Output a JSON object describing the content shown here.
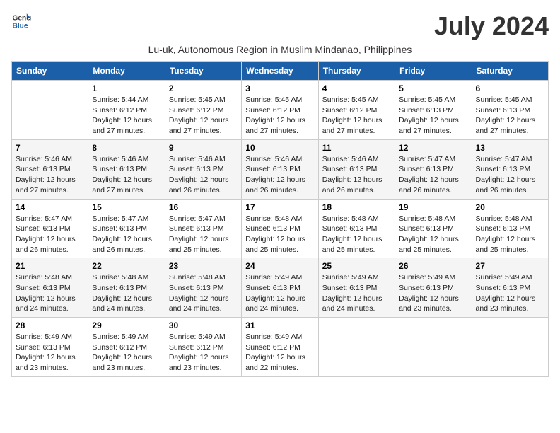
{
  "logo": {
    "line1": "General",
    "line2": "Blue"
  },
  "title": "July 2024",
  "subtitle": "Lu-uk, Autonomous Region in Muslim Mindanao, Philippines",
  "weekdays": [
    "Sunday",
    "Monday",
    "Tuesday",
    "Wednesday",
    "Thursday",
    "Friday",
    "Saturday"
  ],
  "weeks": [
    [
      {
        "day": "",
        "info": ""
      },
      {
        "day": "1",
        "info": "Sunrise: 5:44 AM\nSunset: 6:12 PM\nDaylight: 12 hours\nand 27 minutes."
      },
      {
        "day": "2",
        "info": "Sunrise: 5:45 AM\nSunset: 6:12 PM\nDaylight: 12 hours\nand 27 minutes."
      },
      {
        "day": "3",
        "info": "Sunrise: 5:45 AM\nSunset: 6:12 PM\nDaylight: 12 hours\nand 27 minutes."
      },
      {
        "day": "4",
        "info": "Sunrise: 5:45 AM\nSunset: 6:12 PM\nDaylight: 12 hours\nand 27 minutes."
      },
      {
        "day": "5",
        "info": "Sunrise: 5:45 AM\nSunset: 6:13 PM\nDaylight: 12 hours\nand 27 minutes."
      },
      {
        "day": "6",
        "info": "Sunrise: 5:45 AM\nSunset: 6:13 PM\nDaylight: 12 hours\nand 27 minutes."
      }
    ],
    [
      {
        "day": "7",
        "info": "Sunrise: 5:46 AM\nSunset: 6:13 PM\nDaylight: 12 hours\nand 27 minutes."
      },
      {
        "day": "8",
        "info": "Sunrise: 5:46 AM\nSunset: 6:13 PM\nDaylight: 12 hours\nand 27 minutes."
      },
      {
        "day": "9",
        "info": "Sunrise: 5:46 AM\nSunset: 6:13 PM\nDaylight: 12 hours\nand 26 minutes."
      },
      {
        "day": "10",
        "info": "Sunrise: 5:46 AM\nSunset: 6:13 PM\nDaylight: 12 hours\nand 26 minutes."
      },
      {
        "day": "11",
        "info": "Sunrise: 5:46 AM\nSunset: 6:13 PM\nDaylight: 12 hours\nand 26 minutes."
      },
      {
        "day": "12",
        "info": "Sunrise: 5:47 AM\nSunset: 6:13 PM\nDaylight: 12 hours\nand 26 minutes."
      },
      {
        "day": "13",
        "info": "Sunrise: 5:47 AM\nSunset: 6:13 PM\nDaylight: 12 hours\nand 26 minutes."
      }
    ],
    [
      {
        "day": "14",
        "info": "Sunrise: 5:47 AM\nSunset: 6:13 PM\nDaylight: 12 hours\nand 26 minutes."
      },
      {
        "day": "15",
        "info": "Sunrise: 5:47 AM\nSunset: 6:13 PM\nDaylight: 12 hours\nand 26 minutes."
      },
      {
        "day": "16",
        "info": "Sunrise: 5:47 AM\nSunset: 6:13 PM\nDaylight: 12 hours\nand 25 minutes."
      },
      {
        "day": "17",
        "info": "Sunrise: 5:48 AM\nSunset: 6:13 PM\nDaylight: 12 hours\nand 25 minutes."
      },
      {
        "day": "18",
        "info": "Sunrise: 5:48 AM\nSunset: 6:13 PM\nDaylight: 12 hours\nand 25 minutes."
      },
      {
        "day": "19",
        "info": "Sunrise: 5:48 AM\nSunset: 6:13 PM\nDaylight: 12 hours\nand 25 minutes."
      },
      {
        "day": "20",
        "info": "Sunrise: 5:48 AM\nSunset: 6:13 PM\nDaylight: 12 hours\nand 25 minutes."
      }
    ],
    [
      {
        "day": "21",
        "info": "Sunrise: 5:48 AM\nSunset: 6:13 PM\nDaylight: 12 hours\nand 24 minutes."
      },
      {
        "day": "22",
        "info": "Sunrise: 5:48 AM\nSunset: 6:13 PM\nDaylight: 12 hours\nand 24 minutes."
      },
      {
        "day": "23",
        "info": "Sunrise: 5:48 AM\nSunset: 6:13 PM\nDaylight: 12 hours\nand 24 minutes."
      },
      {
        "day": "24",
        "info": "Sunrise: 5:49 AM\nSunset: 6:13 PM\nDaylight: 12 hours\nand 24 minutes."
      },
      {
        "day": "25",
        "info": "Sunrise: 5:49 AM\nSunset: 6:13 PM\nDaylight: 12 hours\nand 24 minutes."
      },
      {
        "day": "26",
        "info": "Sunrise: 5:49 AM\nSunset: 6:13 PM\nDaylight: 12 hours\nand 23 minutes."
      },
      {
        "day": "27",
        "info": "Sunrise: 5:49 AM\nSunset: 6:13 PM\nDaylight: 12 hours\nand 23 minutes."
      }
    ],
    [
      {
        "day": "28",
        "info": "Sunrise: 5:49 AM\nSunset: 6:13 PM\nDaylight: 12 hours\nand 23 minutes."
      },
      {
        "day": "29",
        "info": "Sunrise: 5:49 AM\nSunset: 6:12 PM\nDaylight: 12 hours\nand 23 minutes."
      },
      {
        "day": "30",
        "info": "Sunrise: 5:49 AM\nSunset: 6:12 PM\nDaylight: 12 hours\nand 23 minutes."
      },
      {
        "day": "31",
        "info": "Sunrise: 5:49 AM\nSunset: 6:12 PM\nDaylight: 12 hours\nand 22 minutes."
      },
      {
        "day": "",
        "info": ""
      },
      {
        "day": "",
        "info": ""
      },
      {
        "day": "",
        "info": ""
      }
    ]
  ]
}
